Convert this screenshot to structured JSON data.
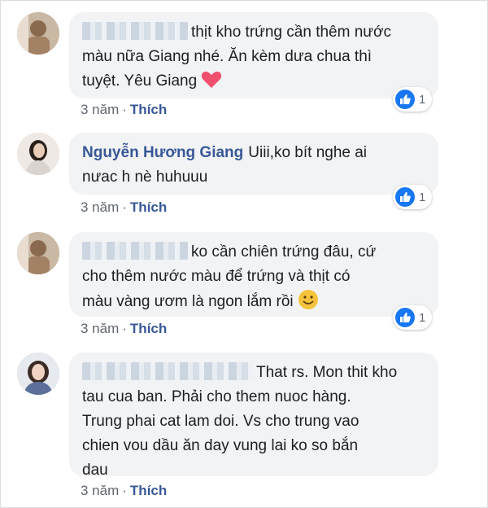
{
  "comments": [
    {
      "author": "",
      "text_line1": "thịt kho trứng cần thêm nước",
      "text_line2": "màu nữa Giang nhé. Ăn kèm dưa chua thì",
      "text_line3": "tuyệt. Yêu Giang",
      "emoji": "red-heart",
      "time": "3 năm",
      "like": "Thích",
      "reactions": "1"
    },
    {
      "author": "Nguyễn Hương Giang",
      "text_line1": "Uiii,ko bít nghe ai",
      "text_line2": "nưac h nè huhuuu",
      "time": "3 năm",
      "like": "Thích",
      "reactions": "1"
    },
    {
      "author": "",
      "text_line1": "ko cần chiên trứng đâu, cứ",
      "text_line2": "cho thêm nước màu để trứng và thịt có",
      "text_line3": "màu vàng ươm là ngon lắm rồi",
      "emoji": "smiling-face",
      "time": "3 năm",
      "like": "Thích",
      "reactions": "1"
    },
    {
      "author": "",
      "text_line1": "That rs. Mon thit kho",
      "text_line2": "tau cua ban. Phải cho them nuoc hàng.",
      "text_line3": "Trung phai cat lam doi. Vs cho trung vao",
      "text_line4": "chien vou dầu ăn day vung lai ko so bắn",
      "text_line5": "dau",
      "time": "3 năm",
      "like": "Thích"
    }
  ],
  "colors": {
    "link": "#385898",
    "bubble": "#f2f3f5",
    "meta": "#606770",
    "like_badge": "#1877f2",
    "heart": "#f0506e",
    "smile": "#f5c33b"
  }
}
